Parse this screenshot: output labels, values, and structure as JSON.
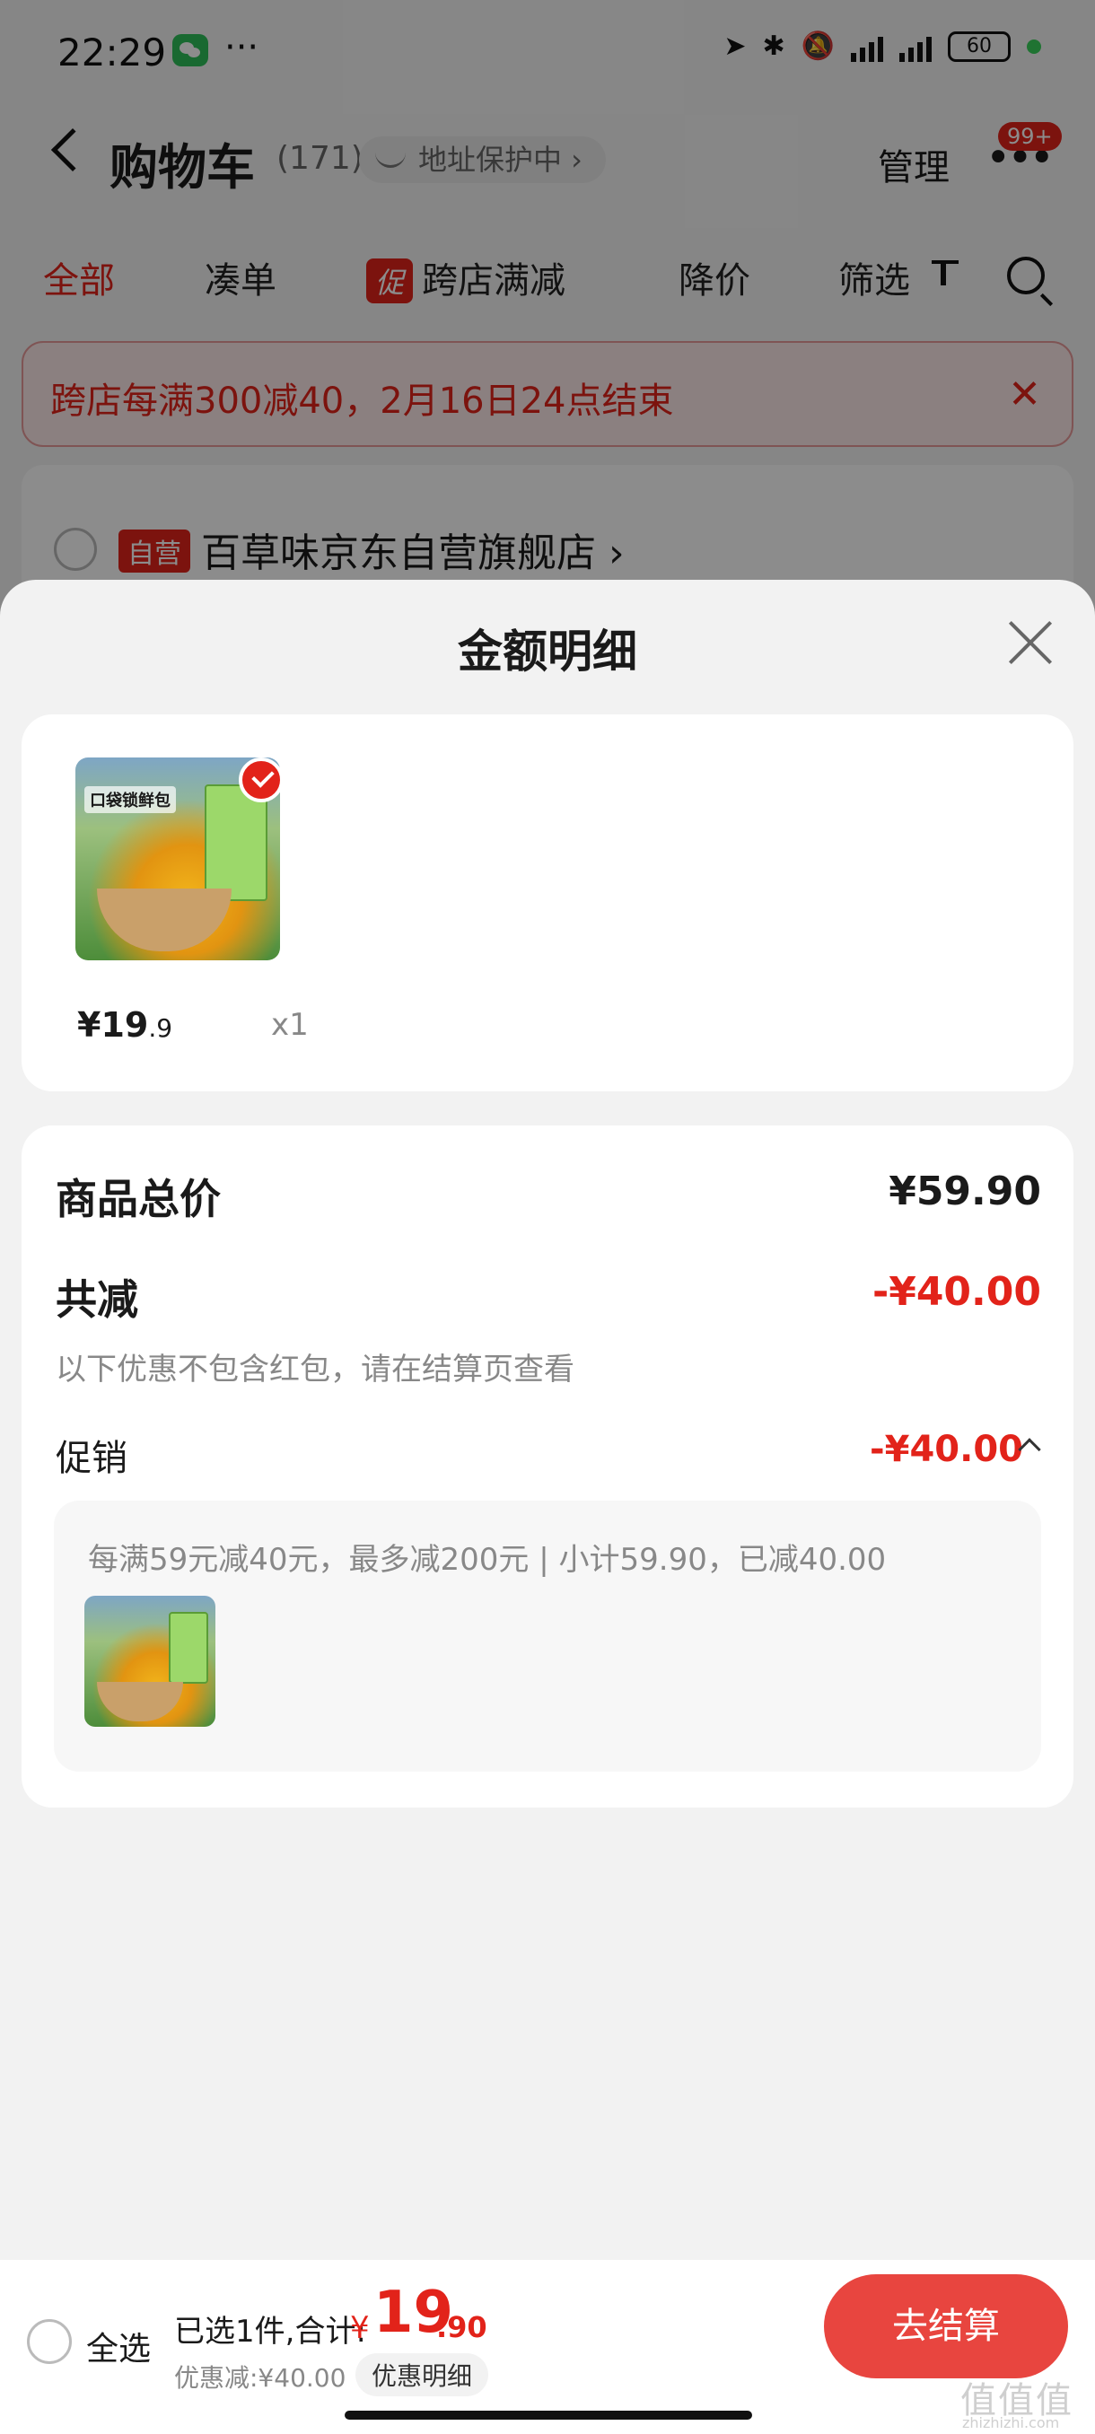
{
  "status_bar": {
    "time": "22:29",
    "more": "···",
    "battery": "60"
  },
  "cart_header": {
    "title": "购物车",
    "count": "(171)",
    "address_pill": "地址保护中 ›",
    "manage": "管理",
    "badge": "99+"
  },
  "tabs": {
    "all": "全部",
    "combine": "凑单",
    "promo_tag": "促",
    "cross_store": "跨店满减",
    "price_drop": "降价",
    "filter": "筛选"
  },
  "notice": {
    "text": "跨店每满300减40，2月16日24点结束",
    "close": "✕"
  },
  "store": {
    "tag": "自营",
    "name": "百草味京东自营旗舰店 ›"
  },
  "sheet": {
    "title": "金额明细",
    "product": {
      "image_text": "口袋锁鲜包",
      "price_yen": "¥19",
      "price_dec": ".9",
      "qty": "x1"
    },
    "summary": {
      "total_label": "商品总价",
      "total_value": "¥59.90",
      "reduce_label": "共减",
      "reduce_value": "-¥40.00",
      "note": "以下优惠不包含红包，请在结算页查看",
      "promo_label": "促销",
      "promo_value": "-¥40.00",
      "promo_desc": "每满59元减40元，最多减200元 | 小计59.90，已减40.00"
    }
  },
  "checkout": {
    "select_all": "全选",
    "selected": "已选1件,合计:",
    "yen": "¥",
    "total_int": "19",
    "total_dec": ".90",
    "discount": "优惠减:¥40.00",
    "detail": "优惠明细",
    "button": "去结算",
    "watermark": "值值值",
    "watermark_sub": "zhizhizhi.com"
  },
  "colors": {
    "accent": "#e2231a",
    "button": "#e8453f"
  }
}
